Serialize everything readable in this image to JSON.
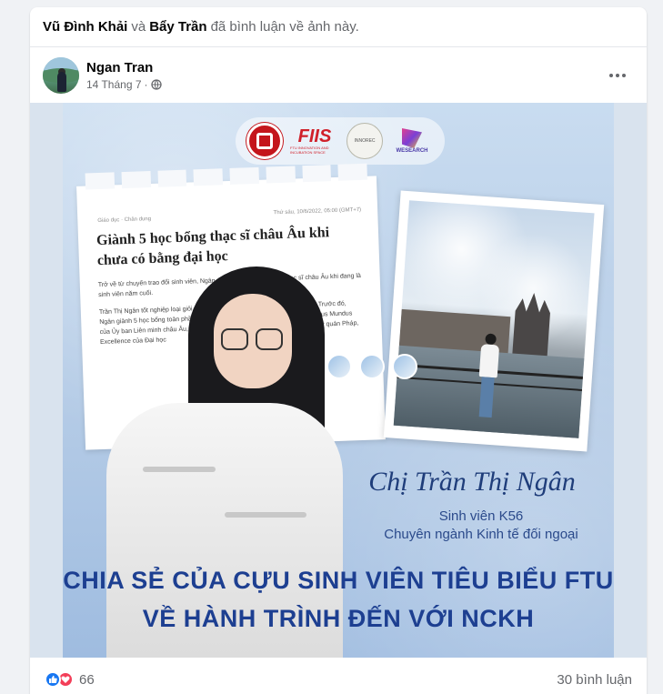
{
  "activity": {
    "user1": "Vũ Đình Khải",
    "connector": "và",
    "user2": "Bẩy Trần",
    "action": "đã bình luận về ảnh này."
  },
  "post": {
    "author": "Ngan Tran",
    "date": "14 Tháng 7",
    "separator": "·",
    "privacy_icon": "globe-icon",
    "more_icon": "more-options-icon"
  },
  "poster": {
    "logos": {
      "fiis": "FIIS",
      "fiis_sub": "FTU INNOVATION AND INCUBATION SPACE",
      "innorec": "INNOREC",
      "wesearch": "WESEARCH"
    },
    "article": {
      "breadcrumb": "Giáo dục · Chân dung",
      "date": "Thứ sáu, 10/6/2022, 05:00 (GMT+7)",
      "headline": "Giành 5 học bổng thạc sĩ châu Âu khi chưa có bằng đại học",
      "para1": "Trở về từ chuyến trao đổi sinh viên, Ngân quyết tâm xin học bổng thạc sĩ châu Âu khi đang là sinh viên năm cuối.",
      "para2": "Trần Thị Ngân tốt nghiệp loại giỏi, Đại học Ngoại thương Hà Nội, hồi tháng 1. Trước đó, Ngân giành 5 học bổng toàn phần bậc thạc sĩ ở châu Âu gồm học bổng Erasmus Mundus của Ủy ban Liên minh châu Âu, Chính phủ Pháp, France Excellence của Đại sứ quán Pháp, Excellence của Đại học"
    },
    "name_script": "Chị Trần Thị Ngân",
    "role_line1": "Sinh viên K56",
    "role_line2": "Chuyên ngành Kinh tế đối ngoại",
    "banner_line1": "CHIA SẺ CỦA CỰU SINH VIÊN TIÊU BIỂU FTU",
    "banner_line2": "VỀ HÀNH TRÌNH ĐẾN VỚI NCKH"
  },
  "footer": {
    "reactions": "66",
    "comments": "30 bình luận"
  },
  "colors": {
    "facebook_blue": "#1877f2",
    "love_red": "#f33e58",
    "poster_navy": "#1d3f91"
  }
}
